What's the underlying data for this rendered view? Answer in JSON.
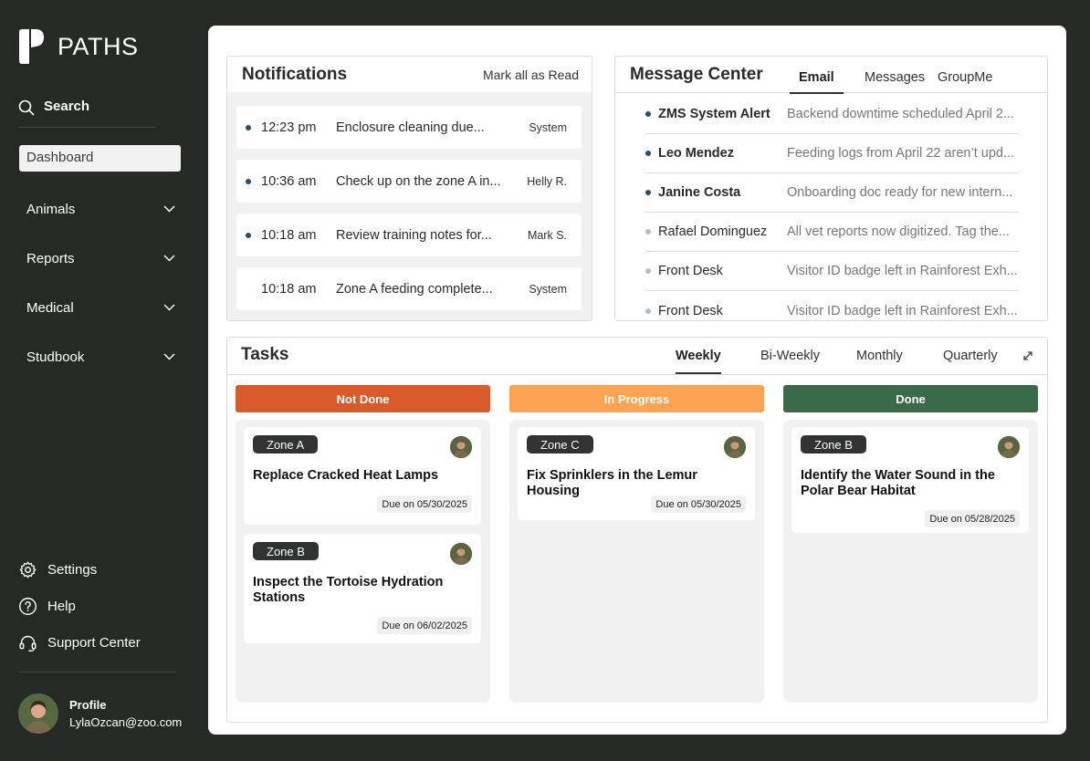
{
  "app": {
    "name": "PATHS"
  },
  "sidebar": {
    "search_label": "Search",
    "dashboard_label": "Dashboard",
    "nav_items": [
      {
        "label": "Animals"
      },
      {
        "label": "Reports"
      },
      {
        "label": "Medical"
      },
      {
        "label": "Studbook"
      }
    ],
    "bottom_items": [
      {
        "label": "Settings",
        "icon": "gear-icon"
      },
      {
        "label": "Help",
        "icon": "help-icon"
      },
      {
        "label": "Support Center",
        "icon": "headset-icon"
      }
    ],
    "profile": {
      "label": "Profile",
      "email": "LylaOzcan@zoo.com"
    }
  },
  "notifications": {
    "title": "Notifications",
    "mark_all_label": "Mark all as Read",
    "items": [
      {
        "time": "12:23 pm",
        "message": "Enclosure cleaning due...",
        "source": "System",
        "unread": true
      },
      {
        "time": "10:36 am",
        "message": "Check up on the zone A in...",
        "source": "Helly R.",
        "unread": true
      },
      {
        "time": "10:18 am",
        "message": "Review training notes for...",
        "source": "Mark S.",
        "unread": true
      },
      {
        "time": "10:18 am",
        "message": "Zone A feeding complete...",
        "source": "System",
        "unread": false
      }
    ]
  },
  "message_center": {
    "title": "Message Center",
    "tabs": [
      {
        "label": "Email",
        "active": true
      },
      {
        "label": "Messages",
        "active": false
      },
      {
        "label": "GroupMe",
        "active": false
      }
    ],
    "messages": [
      {
        "from": "ZMS System Alert",
        "preview": "Backend downtime scheduled April 2...",
        "unread": true
      },
      {
        "from": "Leo Mendez",
        "preview": "Feeding logs from April 22 aren’t upd...",
        "unread": true
      },
      {
        "from": "Janine Costa",
        "preview": "Onboarding doc ready for new intern...",
        "unread": true
      },
      {
        "from": "Rafael Dominguez",
        "preview": "All vet reports now digitized. Tag the...",
        "unread": false
      },
      {
        "from": "Front Desk",
        "preview": "Visitor ID badge left in Rainforest Exh...",
        "unread": false
      },
      {
        "from": "Front Desk",
        "preview": "Visitor ID badge left in Rainforest Exh...",
        "unread": false
      }
    ]
  },
  "tasks": {
    "title": "Tasks",
    "tabs": [
      {
        "label": "Weekly",
        "active": true
      },
      {
        "label": "Bi-Weekly",
        "active": false
      },
      {
        "label": "Monthly",
        "active": false
      },
      {
        "label": "Quarterly",
        "active": false
      }
    ],
    "columns": [
      {
        "label": "Not Done",
        "color": "#d95a2b",
        "cards": [
          {
            "zone": "Zone A",
            "title": "Replace Cracked Heat Lamps",
            "due": "Due on 05/30/2025"
          },
          {
            "zone": "Zone B",
            "title": "Inspect the Tortoise Hydration Stations",
            "due": "Due on 06/02/2025"
          }
        ]
      },
      {
        "label": "In Progress",
        "color": "#fca453",
        "cards": [
          {
            "zone": "Zone C",
            "title": "Fix Sprinklers in the Lemur Housing",
            "due": "Due on 05/30/2025"
          }
        ]
      },
      {
        "label": "Done",
        "color": "#3a6a48",
        "cards": [
          {
            "zone": "Zone B",
            "title": "Identify the Water Sound in the Polar Bear Habitat",
            "due": "Due on 05/28/2025"
          }
        ]
      }
    ]
  }
}
